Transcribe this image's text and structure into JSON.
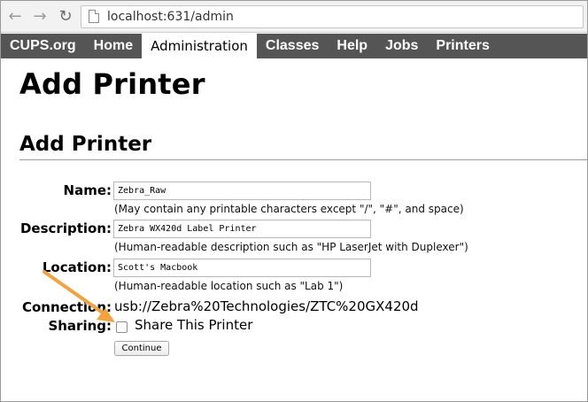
{
  "browser": {
    "url": "localhost:631/admin",
    "back_icon": "arrow-left-icon",
    "forward_icon": "arrow-right-icon",
    "reload_icon": "reload-icon",
    "page_icon": "page-icon"
  },
  "navbar": {
    "tabs": [
      {
        "label": "CUPS.org",
        "active": false
      },
      {
        "label": "Home",
        "active": false
      },
      {
        "label": "Administration",
        "active": true
      },
      {
        "label": "Classes",
        "active": false
      },
      {
        "label": "Help",
        "active": false
      },
      {
        "label": "Jobs",
        "active": false
      },
      {
        "label": "Printers",
        "active": false
      }
    ],
    "background": "#555555"
  },
  "page": {
    "title": "Add Printer",
    "section_title": "Add Printer"
  },
  "form": {
    "name_label": "Name:",
    "name_value": "Zebra_Raw",
    "name_hint": "(May contain any printable characters except \"/\", \"#\", and space)",
    "description_label": "Description:",
    "description_value": "Zebra WX420d Label Printer",
    "description_hint": "(Human-readable description such as \"HP LaserJet with Duplexer\")",
    "location_label": "Location:",
    "location_value": "Scott's Macbook",
    "location_hint": "(Human-readable location such as \"Lab 1\")",
    "connection_label": "Connection:",
    "connection_value": "usb://Zebra%20Technologies/ZTC%20GX420d",
    "sharing_label": "Sharing:",
    "sharing_checkbox_label": "Share This Printer",
    "sharing_checked": false,
    "continue_label": "Continue"
  },
  "annotation": {
    "arrow_color": "#f5a13c"
  }
}
